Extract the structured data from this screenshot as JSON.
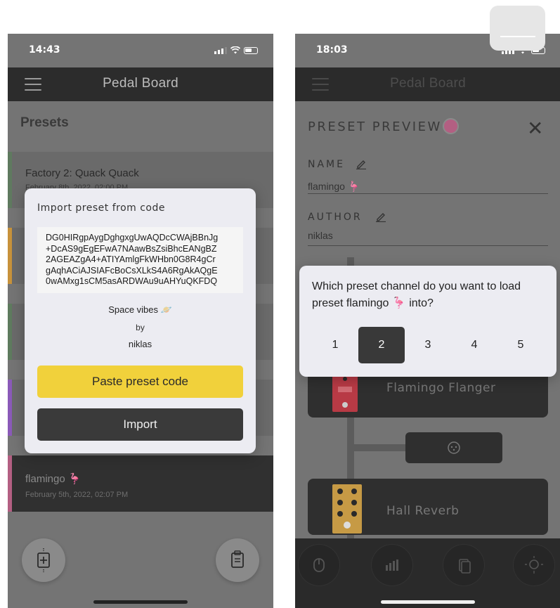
{
  "left": {
    "status_time": "14:43",
    "app_title": "Pedal Board",
    "presets_heading": "Presets",
    "presets": [
      {
        "name": "Factory 2: Quack Quack",
        "date": "February 8th, 2022, 02:00 PM",
        "stripe": "#5f7a5f"
      },
      {
        "name": "",
        "date": "",
        "stripe": "#c7923b"
      },
      {
        "name": "",
        "date": "",
        "stripe": "#5e7b5e"
      },
      {
        "name": "",
        "date": "",
        "stripe": "#8a5ab8"
      },
      {
        "name": "flamingo 🦩",
        "date": "February 5th, 2022, 02:07 PM",
        "stripe": "#b35f82"
      }
    ],
    "modal": {
      "title": "Import preset from code",
      "code": "DG0HIRgpAygDghgxgUwAQDcCWAjBBnJg\n+DcAS9gEgEFwA7NAawBsZsiBhcEANgBZ\n2AGEAZgA4+ATIYAmlgFkWHbn0G8R4gCr\ngAqhACiAJSIAFcBoCsXLkS4A6RgAkAQgE\n0wAMxg1sCM5asARDWAu9uAHYuQKFDQ",
      "preset_name": "Space vibes 🪐",
      "by": "by",
      "author": "niklas",
      "paste_label": "Paste preset code",
      "import_label": "Import"
    }
  },
  "right": {
    "status_time": "18:03",
    "app_title": "Pedal Board",
    "preview_title": "PRESET PREVIEW",
    "name_label": "NAME",
    "name_value": "flamingo 🦩",
    "author_label": "AUTHOR",
    "author_value": "niklas",
    "channel_prompt": "Which preset channel do you want to load preset flamingo 🦩 into?",
    "channels": [
      "1",
      "2",
      "3",
      "4",
      "5"
    ],
    "selected_channel": "2",
    "pedals": [
      "Flamingo Flanger",
      "Hall Reverb"
    ],
    "colors": {
      "preset_dot": "#b35f82",
      "selected": "#393939",
      "accent_yellow": "#f1d13b"
    }
  }
}
